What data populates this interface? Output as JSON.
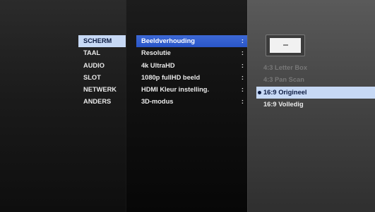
{
  "main_menu": {
    "items": [
      {
        "label": "SCHERM",
        "selected": true
      },
      {
        "label": "TAAL",
        "selected": false
      },
      {
        "label": "AUDIO",
        "selected": false
      },
      {
        "label": "SLOT",
        "selected": false
      },
      {
        "label": "NETWERK",
        "selected": false
      },
      {
        "label": "ANDERS",
        "selected": false
      }
    ]
  },
  "sub_menu": {
    "items": [
      {
        "label": "Beeldverhouding",
        "colon": ":",
        "active": true
      },
      {
        "label": "Resolutie",
        "colon": ":",
        "active": false
      },
      {
        "label": "4k UltraHD",
        "colon": ":",
        "active": false
      },
      {
        "label": "1080p fullHD beeld",
        "colon": ":",
        "active": false
      },
      {
        "label": "HDMI Kleur instelling.",
        "colon": ":",
        "active": false
      },
      {
        "label": "3D-modus",
        "colon": ":",
        "active": false
      }
    ]
  },
  "options": {
    "items": [
      {
        "label": "4:3 Letter Box",
        "state": "disabled"
      },
      {
        "label": "4:3 Pan Scan",
        "state": "disabled"
      },
      {
        "label": "16:9 Origineel",
        "state": "selected"
      },
      {
        "label": "16:9 Volledig",
        "state": "normal"
      }
    ]
  },
  "colors": {
    "highlight_light": "#c7d9f5",
    "highlight_blue": "#2a56c8",
    "text": "#eaeaea",
    "disabled_text": "#777777"
  }
}
